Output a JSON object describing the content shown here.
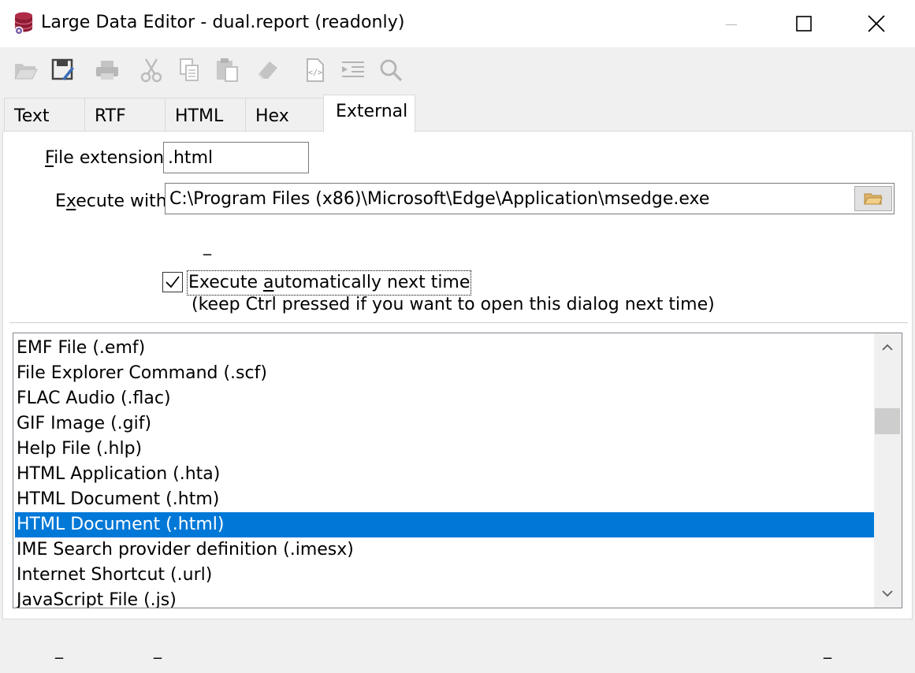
{
  "window": {
    "title": "Large Data Editor - dual.report (readonly)",
    "minimize_glyph": "—"
  },
  "toolbar": {
    "icons": [
      "open-folder-icon",
      "save-icon",
      "print-icon",
      "cut-icon",
      "copy-icon",
      "paste-icon",
      "eraser-icon",
      "source-document-icon",
      "indent-icon",
      "search-icon"
    ]
  },
  "tabs": [
    {
      "label": "Text"
    },
    {
      "label": "RTF"
    },
    {
      "label": "HTML"
    },
    {
      "label": "Hex"
    },
    {
      "label": "External",
      "active": true
    }
  ],
  "external": {
    "file_extension_label_access": "F",
    "file_extension_label_rest": "ile extension",
    "file_extension_value": ".html",
    "execute_with_label_pre": "E",
    "execute_with_label_access": "x",
    "execute_with_label_rest": "ecute with",
    "execute_with_value": "C:\\Program Files (x86)\\Microsoft\\Edge\\Application\\msedge.exe",
    "small_dash": "_",
    "auto_checkbox_checked": true,
    "auto_label_pre": "Execute ",
    "auto_label_access": "a",
    "auto_label_rest": "utomatically next time",
    "auto_hint": "(keep Ctrl pressed if you want to open this dialog next time)"
  },
  "file_types": [
    {
      "label": "EMF File  (.emf)"
    },
    {
      "label": "File Explorer Command  (.scf)"
    },
    {
      "label": "FLAC Audio  (.flac)"
    },
    {
      "label": "GIF Image  (.gif)"
    },
    {
      "label": "Help File  (.hlp)"
    },
    {
      "label": "HTML Application  (.hta)"
    },
    {
      "label": "HTML Document  (.htm)"
    },
    {
      "label": "HTML Document  (.html)",
      "selected": true
    },
    {
      "label": "IME Search provider definition  (.imesx)"
    },
    {
      "label": "Internet Shortcut  (.url)"
    },
    {
      "label": "JavaScript File  (.js)"
    }
  ],
  "scroll_position_fraction": 0.3,
  "bottom": {
    "dash_1": "_",
    "dash_2": "_",
    "dash_3": "_"
  },
  "colors": {
    "selection": "#0078d7",
    "app_icon": "#a4203c"
  }
}
